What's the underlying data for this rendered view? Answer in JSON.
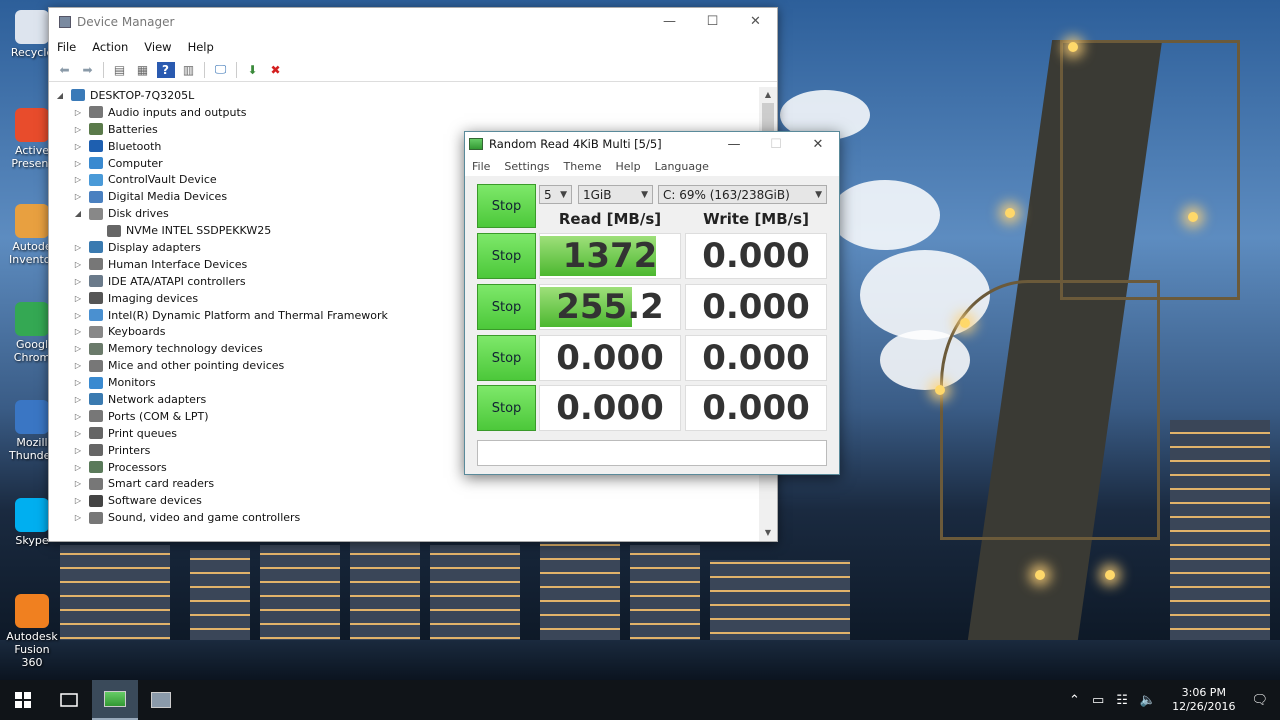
{
  "desktop": {
    "icons": [
      {
        "label": "Recycle",
        "color": "#dde4ee"
      },
      {
        "label": "Active Present",
        "color": "#e84c2c"
      },
      {
        "label": "Autode Inventor",
        "color": "#e8a040"
      },
      {
        "label": "Googl Chrom",
        "color": "#34a853"
      },
      {
        "label": "Mozill Thunder",
        "color": "#3a76c4"
      },
      {
        "label": "Skype",
        "color": "#00aff0"
      },
      {
        "label": "Autodesk Fusion 360",
        "color": "#f08020"
      }
    ]
  },
  "device_manager": {
    "title": "Device Manager",
    "menu": [
      "File",
      "Action",
      "View",
      "Help"
    ],
    "root": "DESKTOP-7Q3205L",
    "nodes": [
      {
        "label": "Audio inputs and outputs",
        "expander": "▷",
        "color": "#777"
      },
      {
        "label": "Batteries",
        "expander": "▷",
        "color": "#5a7a4a"
      },
      {
        "label": "Bluetooth",
        "expander": "▷",
        "color": "#1e5fb0"
      },
      {
        "label": "Computer",
        "expander": "▷",
        "color": "#3a8ad0"
      },
      {
        "label": "ControlVault Device",
        "expander": "▷",
        "color": "#4a9ad8"
      },
      {
        "label": "Digital Media Devices",
        "expander": "▷",
        "color": "#4a80c0"
      },
      {
        "label": "Disk drives",
        "expander": "◢",
        "color": "#888"
      },
      {
        "label": "NVMe INTEL SSDPEKKW25",
        "expander": "",
        "color": "#666",
        "child": true
      },
      {
        "label": "Display adapters",
        "expander": "▷",
        "color": "#3a7ab0"
      },
      {
        "label": "Human Interface Devices",
        "expander": "▷",
        "color": "#777"
      },
      {
        "label": "IDE ATA/ATAPI controllers",
        "expander": "▷",
        "color": "#6a7a8a"
      },
      {
        "label": "Imaging devices",
        "expander": "▷",
        "color": "#555"
      },
      {
        "label": "Intel(R) Dynamic Platform and Thermal Framework",
        "expander": "▷",
        "color": "#4a90d0"
      },
      {
        "label": "Keyboards",
        "expander": "▷",
        "color": "#888"
      },
      {
        "label": "Memory technology devices",
        "expander": "▷",
        "color": "#6a7a6a"
      },
      {
        "label": "Mice and other pointing devices",
        "expander": "▷",
        "color": "#777"
      },
      {
        "label": "Monitors",
        "expander": "▷",
        "color": "#3a8ad0"
      },
      {
        "label": "Network adapters",
        "expander": "▷",
        "color": "#3a7ab0"
      },
      {
        "label": "Ports (COM & LPT)",
        "expander": "▷",
        "color": "#777"
      },
      {
        "label": "Print queues",
        "expander": "▷",
        "color": "#666"
      },
      {
        "label": "Printers",
        "expander": "▷",
        "color": "#666"
      },
      {
        "label": "Processors",
        "expander": "▷",
        "color": "#5a7a5a"
      },
      {
        "label": "Smart card readers",
        "expander": "▷",
        "color": "#777"
      },
      {
        "label": "Software devices",
        "expander": "▷",
        "color": "#444"
      },
      {
        "label": "Sound, video and game controllers",
        "expander": "▷",
        "color": "#777"
      }
    ]
  },
  "benchmark": {
    "title": "Random Read 4KiB Multi [5/5]",
    "menu": [
      "File",
      "Settings",
      "Theme",
      "Help",
      "Language"
    ],
    "count": "5",
    "size": "1GiB",
    "drive": "C: 69% (163/238GiB)",
    "all_button": "Stop",
    "read_header": "Read [MB/s]",
    "write_header": "Write [MB/s]",
    "rows": [
      {
        "button": "Stop",
        "read": "1372",
        "write": "0.000",
        "read_fill": 0.83
      },
      {
        "button": "Stop",
        "read": "255.2",
        "write": "0.000",
        "read_fill": 0.66
      },
      {
        "button": "Stop",
        "read": "0.000",
        "write": "0.000",
        "read_fill": 0
      },
      {
        "button": "Stop",
        "read": "0.000",
        "write": "0.000",
        "read_fill": 0
      }
    ]
  },
  "taskbar": {
    "time": "3:06 PM",
    "date": "12/26/2016"
  }
}
